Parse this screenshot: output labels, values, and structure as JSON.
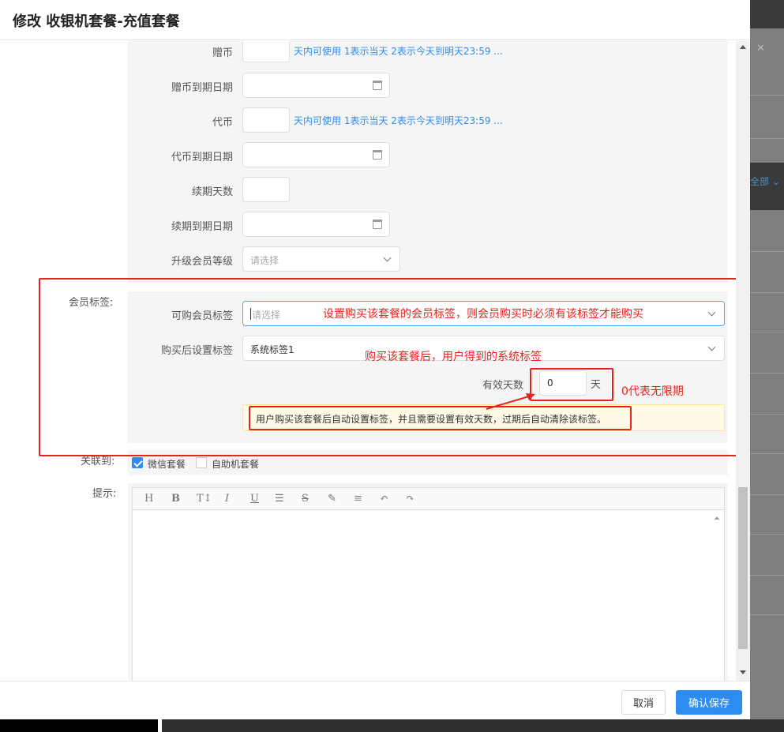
{
  "modal": {
    "title": "修改 收银机套餐-充值套餐",
    "cancel_label": "取消",
    "save_label": "确认保存"
  },
  "background": {
    "all_label": "全部 ⌄"
  },
  "form": {
    "gift_coin": {
      "label": "赠币",
      "hint": "天内可使用 1表示当天 2表示今天到明天23:59 ..."
    },
    "gift_coin_expiry": {
      "label": "赠币到期日期"
    },
    "token_coin": {
      "label": "代币",
      "hint": "天内可使用 1表示当天 2表示今天到明天23:59 ..."
    },
    "token_coin_expiry": {
      "label": "代币到期日期"
    },
    "renew_days": {
      "label": "续期天数"
    },
    "renew_expiry": {
      "label": "续期到期日期"
    },
    "upgrade_level": {
      "label": "升级会员等级",
      "placeholder": "请选择"
    },
    "member_tags": {
      "section_label": "会员标签:",
      "purchasable_label": "可购会员标签",
      "purchasable_placeholder": "请选择",
      "after_purchase_label": "购买后设置标签",
      "after_purchase_value": "系统标签1",
      "valid_days_label": "有效天数",
      "valid_days_value": "0",
      "valid_days_unit": "天",
      "warning": "用户购买该套餐后自动设置标签，并且需要设置有效天数，过期后自动清除该标签。"
    },
    "linked": {
      "label": "关联到:",
      "options": [
        {
          "label": "微信套餐",
          "checked": true
        },
        {
          "label": "自助机套餐",
          "checked": false
        }
      ]
    },
    "tip": {
      "label": "提示:"
    }
  },
  "editor_tools": [
    "H",
    "B",
    "T↕",
    "I",
    "U",
    "☰",
    "S",
    "✎",
    "≡",
    "↶",
    "↷"
  ],
  "annotations": {
    "purchasable_note": "设置购买该套餐的会员标签，则会员购买时必须有该标签才能购买",
    "after_purchase_note": "购买该套餐后，用户得到的系统标签",
    "zero_note": "0代表无限期"
  },
  "colors": {
    "primary": "#2d8cf0",
    "annotation": "#e8231d"
  }
}
